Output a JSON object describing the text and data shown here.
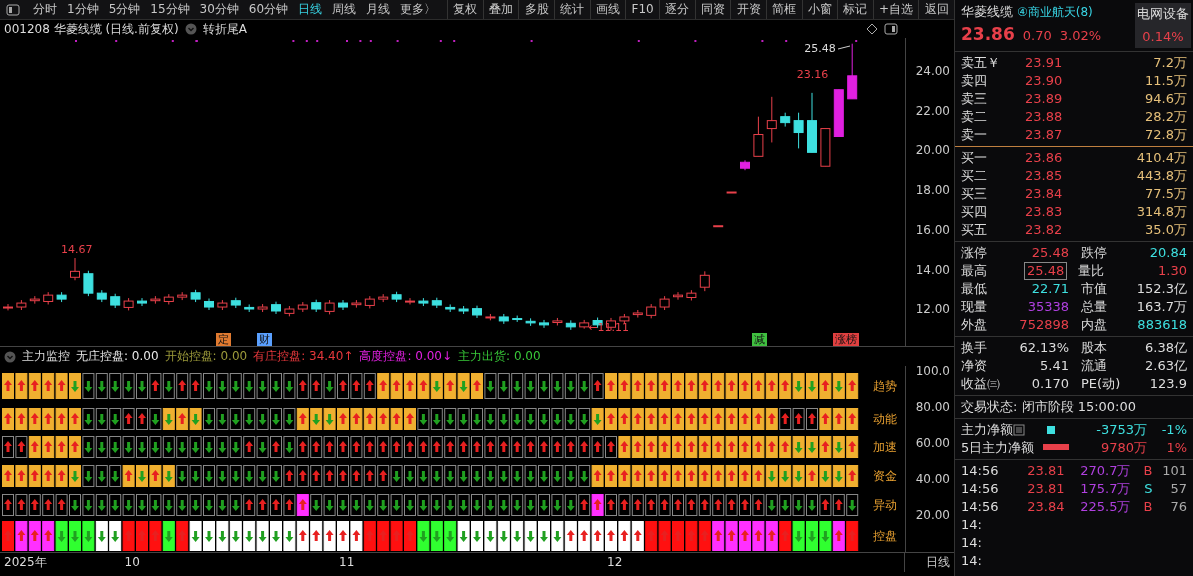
{
  "toolbar": {
    "periods": [
      {
        "label": "分时",
        "selected": false
      },
      {
        "label": "1分钟",
        "selected": false
      },
      {
        "label": "5分钟",
        "selected": false
      },
      {
        "label": "15分钟",
        "selected": false
      },
      {
        "label": "30分钟",
        "selected": false
      },
      {
        "label": "60分钟",
        "selected": false
      },
      {
        "label": "日线",
        "selected": true
      },
      {
        "label": "周线",
        "selected": false
      },
      {
        "label": "月线",
        "selected": false
      },
      {
        "label": "更多〉",
        "selected": false
      }
    ],
    "buttons": [
      "复权",
      "叠加",
      "多股",
      "统计",
      "画线",
      "F10",
      "逐分",
      "同资",
      "开资",
      "简框",
      "小窗",
      "标记",
      "+自选",
      "返回"
    ]
  },
  "chart": {
    "title": "001208 华菱线缆 (日线.前复权)",
    "formula": "转折尾A",
    "price_ticks": [
      "24.00",
      "22.00",
      "20.00",
      "18.00",
      "16.00",
      "14.00",
      "12.00"
    ],
    "price_labels": [
      "14.67",
      "←11.11",
      "23.16",
      "25.48"
    ],
    "events": [
      {
        "label": "定",
        "color": "#e07a30"
      },
      {
        "label": "财",
        "color": "#5aa0ff"
      },
      {
        "label": "减",
        "color": "#40c040"
      },
      {
        "label": "涨榜",
        "color": "#e04040"
      }
    ]
  },
  "indicator": {
    "name": "主力监控",
    "items": [
      {
        "label": "无庄控盘:",
        "value": "0.00",
        "color": "#e8e8e8"
      },
      {
        "label": "开始控盘:",
        "value": "0.00",
        "color": "#9c9a3a"
      },
      {
        "label": "有庄控盘:",
        "value": "34.40",
        "arrow": "↑",
        "color": "#e8383c"
      },
      {
        "label": "高度控盘:",
        "value": "0.00",
        "arrow": "↓",
        "color": "#e020e0"
      },
      {
        "label": "主力出货:",
        "value": "0.00",
        "color": "#38c838"
      }
    ],
    "rows": [
      "趋势",
      "动能",
      "加速",
      "资金",
      "异动",
      "控盘"
    ],
    "ticks": [
      "100.0",
      "80.00",
      "60.00",
      "40.00",
      "20.00"
    ]
  },
  "date_axis": {
    "labels": [
      "2025年",
      "10",
      "11",
      "12"
    ],
    "period": "日线"
  },
  "quote": {
    "name": "华菱线缆",
    "sector": "④商业航天(8)",
    "industry": "电网设备",
    "industry_change": "0.14%",
    "price": "23.86",
    "change": "0.70",
    "change_pct": "3.02%",
    "asks": [
      {
        "label": "卖五￥",
        "price": "23.91",
        "volume": "7.2万"
      },
      {
        "label": "卖四",
        "price": "23.90",
        "volume": "11.5万"
      },
      {
        "label": "卖三",
        "price": "23.89",
        "volume": "94.6万"
      },
      {
        "label": "卖二",
        "price": "23.88",
        "volume": "28.2万"
      },
      {
        "label": "卖一",
        "price": "23.87",
        "volume": "72.8万"
      }
    ],
    "bids": [
      {
        "label": "买一",
        "price": "23.86",
        "volume": "410.4万"
      },
      {
        "label": "买二",
        "price": "23.85",
        "volume": "443.8万"
      },
      {
        "label": "买三",
        "price": "23.84",
        "volume": "77.5万"
      },
      {
        "label": "买四",
        "price": "23.83",
        "volume": "314.8万"
      },
      {
        "label": "买五",
        "price": "23.82",
        "volume": "35.0万"
      }
    ],
    "stats": [
      {
        "label": "涨停",
        "value": "25.48",
        "kind": "up"
      },
      {
        "label": "跌停",
        "value": "20.84",
        "kind": "down"
      },
      {
        "label": "最高",
        "value": "25.48",
        "kind": "up",
        "boxed": true
      },
      {
        "label": "量比",
        "value": "1.30",
        "kind": "up"
      },
      {
        "label": "最低",
        "value": "22.71",
        "kind": "down"
      },
      {
        "label": "市值",
        "value": "152.3亿",
        "kind": "flat"
      },
      {
        "label": "现量",
        "value": "35338",
        "kind": "volume"
      },
      {
        "label": "总量",
        "value": "163.7万",
        "kind": "flat"
      },
      {
        "label": "外盘",
        "value": "752898",
        "kind": "up"
      },
      {
        "label": "内盘",
        "value": "883618",
        "kind": "down"
      }
    ],
    "fundamentals": [
      {
        "label": "换手",
        "value": "62.13%"
      },
      {
        "label": "股本",
        "value": "6.38亿"
      },
      {
        "label": "净资",
        "value": "5.41"
      },
      {
        "label": "流通",
        "value": "2.63亿"
      },
      {
        "label": "收益㈢",
        "value": "0.170"
      },
      {
        "label": "PE(动)",
        "value": "123.9"
      }
    ],
    "status": "交易状态: 闭市阶段 15:00:00",
    "flows": [
      {
        "label": "主力净额",
        "kind": "square",
        "value": "-3753万",
        "pct": "-1%",
        "color": "#3ee0e0"
      },
      {
        "label": "5日主力净额",
        "kind": "bar",
        "value": "9780万",
        "pct": "1%",
        "color": "#e8404a"
      }
    ],
    "trades": [
      {
        "time": "14:56",
        "price": "23.81",
        "amount": "270.7万",
        "side": "B",
        "count": "101"
      },
      {
        "time": "14:56",
        "price": "23.81",
        "amount": "175.7万",
        "side": "S",
        "count": "57"
      },
      {
        "time": "14:56",
        "price": "23.84",
        "amount": "225.5万",
        "side": "B",
        "count": "76"
      },
      {
        "time": "14:"
      },
      {
        "time": "14:"
      },
      {
        "time": "14:"
      }
    ]
  }
}
